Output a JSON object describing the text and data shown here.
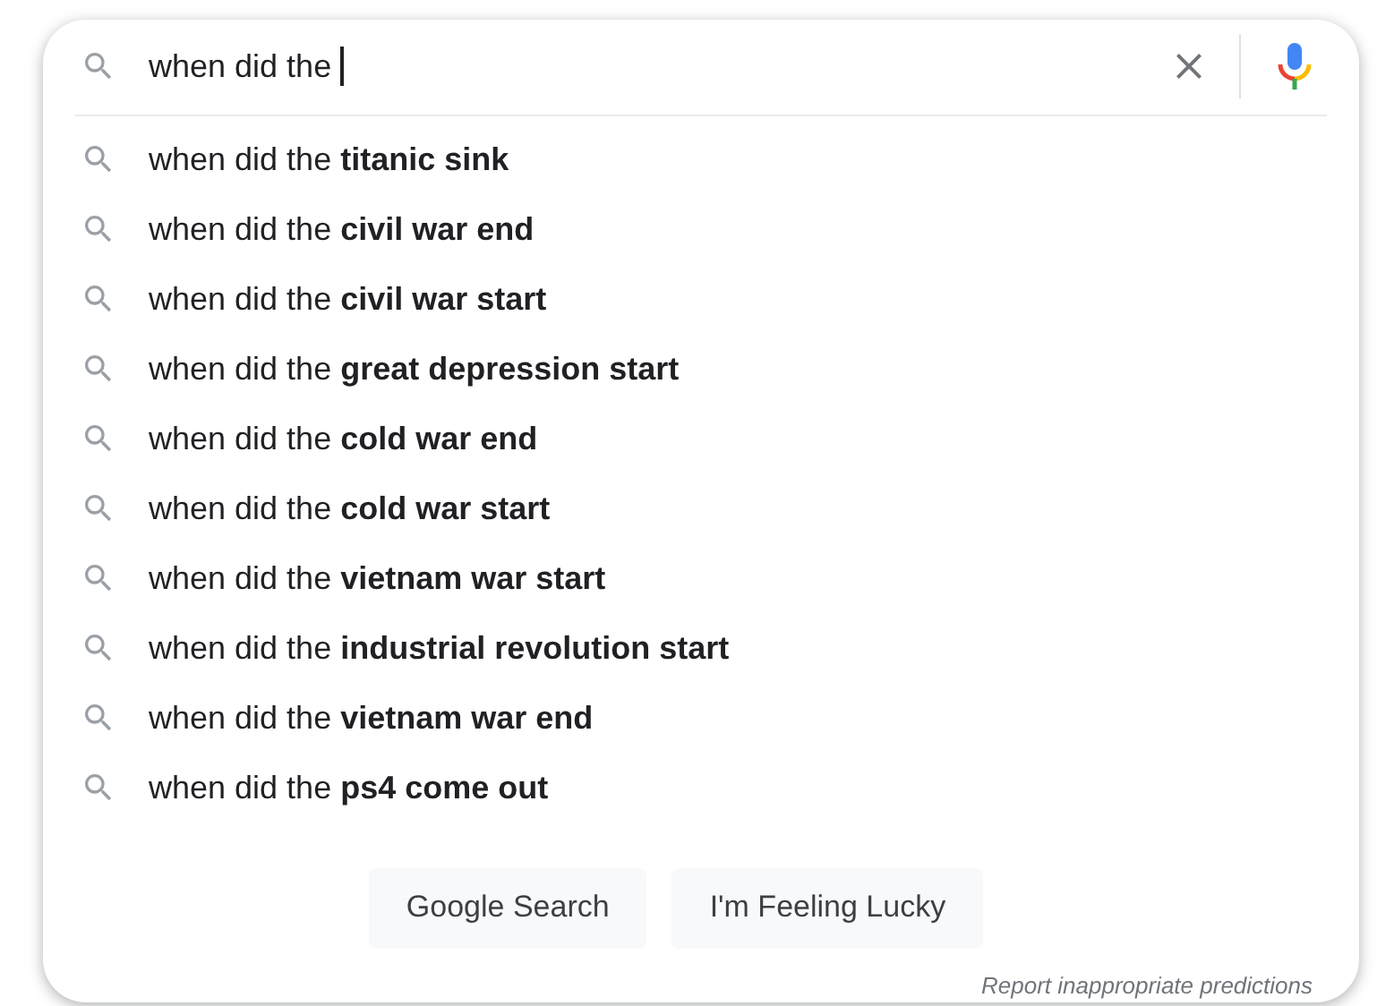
{
  "search": {
    "value": "when did the"
  },
  "suggestions": [
    "when did the **titanic sink**",
    "when did the **civil war end**",
    "when did the **civil war start**",
    "when did the **great depression start**",
    "when did the **cold war end**",
    "when did the **cold war start**",
    "when did the **vietnam war start**",
    "when did the **industrial revolution start**",
    "when did the **vietnam war end**",
    "when did the **ps4 come out**"
  ],
  "buttons": [
    "Google Search",
    "I'm Feeling Lucky"
  ],
  "report_link": "Report inappropriate predictions"
}
